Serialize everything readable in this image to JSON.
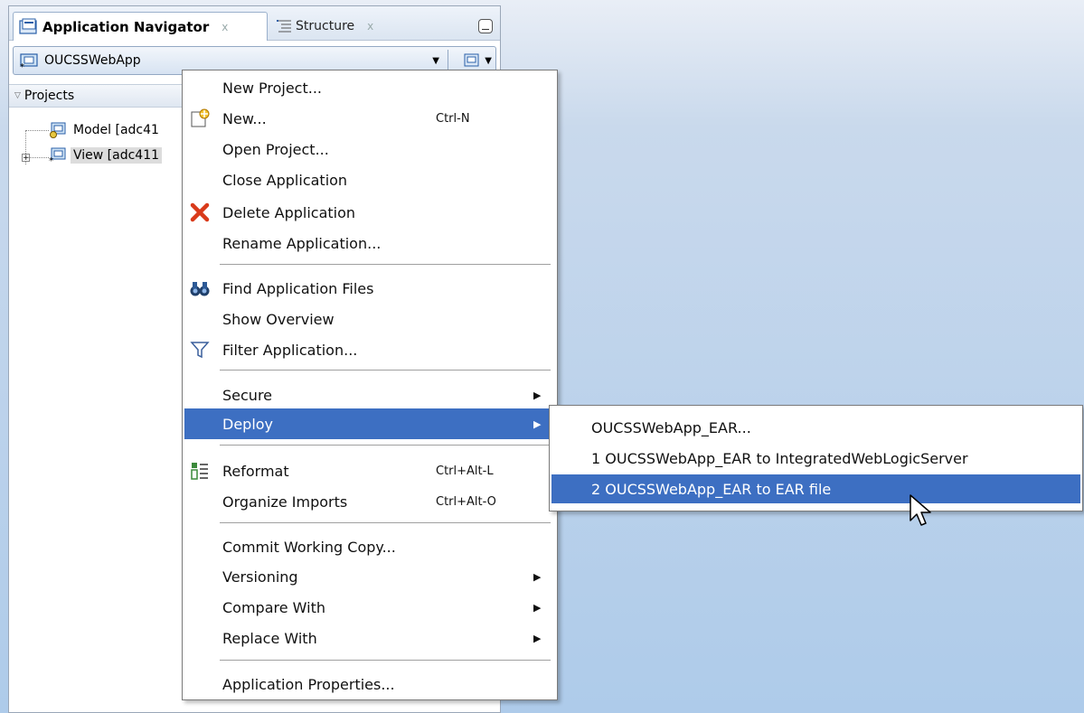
{
  "panel": {
    "active_tab": "Application Navigator",
    "inactive_tab": "Structure",
    "close_glyph": "x",
    "app_name": "OUCSSWebApp",
    "projects_label": "Projects",
    "tree": [
      {
        "label": "Model [adc41"
      },
      {
        "label": "View [adc411"
      }
    ]
  },
  "menu": {
    "items": [
      {
        "key": "new_project",
        "label": "New Project...",
        "shortcut": ""
      },
      {
        "key": "new",
        "label": "New...",
        "shortcut": "Ctrl-N",
        "icon": "new-gallery-icon"
      },
      {
        "key": "open_project",
        "label": "Open Project...",
        "shortcut": ""
      },
      {
        "key": "close_app",
        "label": "Close Application",
        "shortcut": ""
      },
      {
        "key": "delete_app",
        "label": "Delete Application",
        "shortcut": "",
        "icon": "delete-x-icon"
      },
      {
        "key": "rename_app",
        "label": "Rename Application...",
        "shortcut": ""
      },
      {
        "key": "find_files",
        "label": "Find Application Files",
        "shortcut": "",
        "icon": "binoculars-icon"
      },
      {
        "key": "show_overview",
        "label": "Show Overview",
        "shortcut": ""
      },
      {
        "key": "filter_app",
        "label": "Filter Application...",
        "shortcut": "",
        "icon": "funnel-icon"
      },
      {
        "key": "secure",
        "label": "Secure",
        "submenu": true
      },
      {
        "key": "deploy",
        "label": "Deploy",
        "submenu": true,
        "highlighted": true
      },
      {
        "key": "reformat",
        "label": "Reformat",
        "shortcut": "Ctrl+Alt-L",
        "icon": "reformat-icon"
      },
      {
        "key": "organize_imports",
        "label": "Organize Imports",
        "shortcut": "Ctrl+Alt-O"
      },
      {
        "key": "commit",
        "label": "Commit Working Copy..."
      },
      {
        "key": "versioning",
        "label": "Versioning",
        "submenu": true
      },
      {
        "key": "compare_with",
        "label": "Compare With",
        "submenu": true
      },
      {
        "key": "replace_with",
        "label": "Replace With",
        "submenu": true
      },
      {
        "key": "app_properties",
        "label": "Application Properties..."
      }
    ]
  },
  "deploy_submenu": {
    "items": [
      {
        "label": "OUCSSWebApp_EAR..."
      },
      {
        "label": "1  OUCSSWebApp_EAR to IntegratedWebLogicServer"
      },
      {
        "label": "2  OUCSSWebApp_EAR to EAR file",
        "highlighted": true
      }
    ]
  },
  "colors": {
    "highlight": "#3d6fc2",
    "background_gradient_end": "#aecbea",
    "delete_icon": "#d93a1a"
  }
}
